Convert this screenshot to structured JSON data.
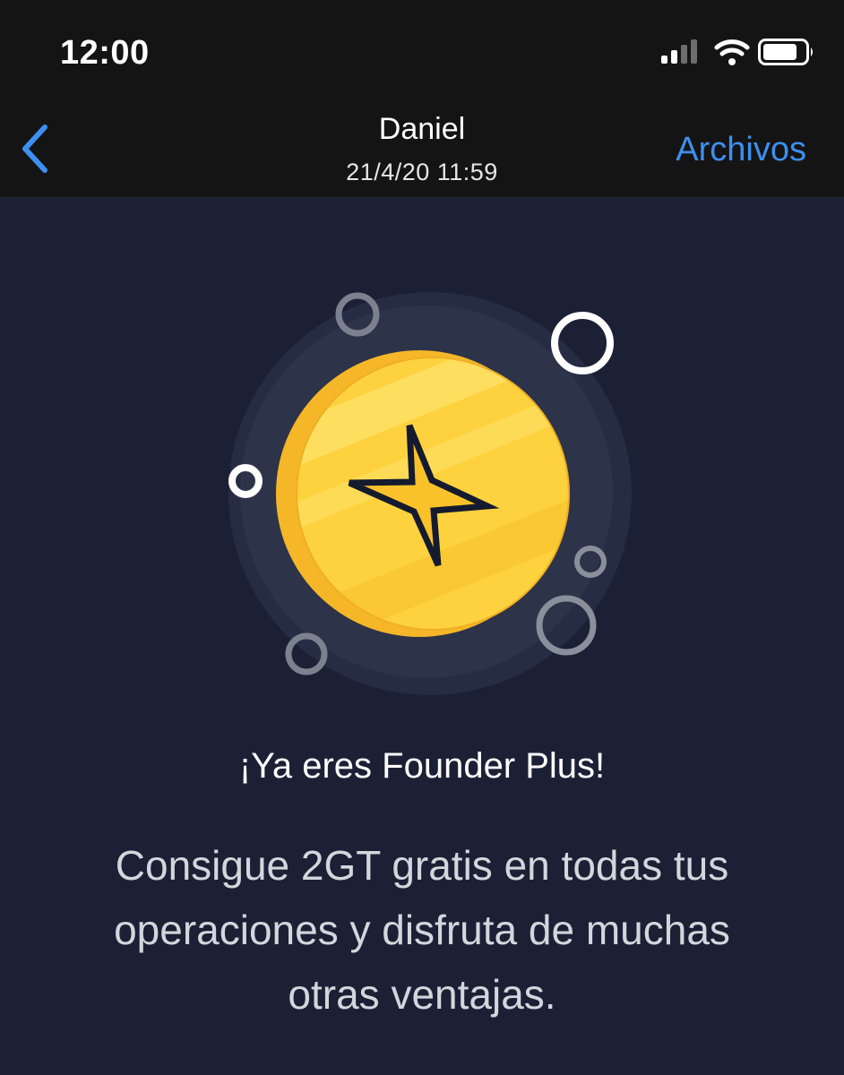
{
  "status_bar": {
    "time": "12:00",
    "icons": [
      "signal-icon",
      "wifi-icon",
      "battery-icon"
    ]
  },
  "nav": {
    "back_icon": "chevron-left-icon",
    "title": "Daniel",
    "subtitle": "21/4/20 11:59",
    "files_label": "Archivos"
  },
  "content": {
    "illustration_icon": "gold-coin-plus-icon",
    "headline": "¡Ya eres Founder Plus!",
    "description": "Consigue 2GT gratis en todas tus operaciones y disfruta de muchas otras ventajas."
  },
  "colors": {
    "background": "#1b2035",
    "top_bar": "#141414",
    "accent_link": "#3d8ff0",
    "coin_gold": "#f5b728"
  }
}
